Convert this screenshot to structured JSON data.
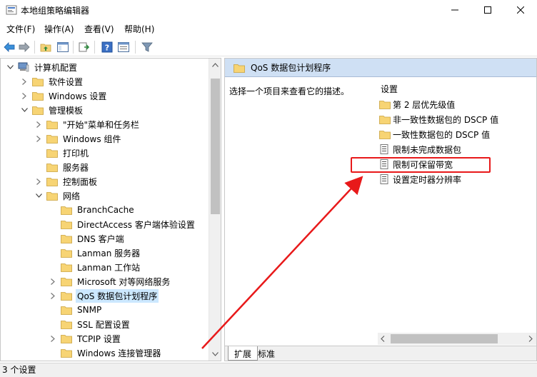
{
  "window": {
    "title": "本地组策略编辑器"
  },
  "menu": [
    "文件(F)",
    "操作(A)",
    "查看(V)",
    "帮助(H)"
  ],
  "tree": [
    {
      "label": "计算机配置",
      "exp": "open",
      "icon": "computer"
    },
    {
      "label": "软件设置",
      "exp": "closed",
      "icon": "folder"
    },
    {
      "label": "Windows 设置",
      "exp": "closed",
      "icon": "folder"
    },
    {
      "label": "管理模板",
      "exp": "open",
      "icon": "folder"
    },
    {
      "label": "\"开始\"菜单和任务栏",
      "exp": "closed",
      "icon": "folder"
    },
    {
      "label": "Windows 组件",
      "exp": "closed",
      "icon": "folder"
    },
    {
      "label": "打印机",
      "exp": "none",
      "icon": "folder"
    },
    {
      "label": "服务器",
      "exp": "none",
      "icon": "folder"
    },
    {
      "label": "控制面板",
      "exp": "closed",
      "icon": "folder"
    },
    {
      "label": "网络",
      "exp": "open",
      "icon": "folder"
    },
    {
      "label": "BranchCache",
      "exp": "none",
      "icon": "folder"
    },
    {
      "label": "DirectAccess 客户端体验设置",
      "exp": "none",
      "icon": "folder"
    },
    {
      "label": "DNS 客户端",
      "exp": "none",
      "icon": "folder"
    },
    {
      "label": "Lanman 服务器",
      "exp": "none",
      "icon": "folder"
    },
    {
      "label": "Lanman 工作站",
      "exp": "none",
      "icon": "folder"
    },
    {
      "label": "Microsoft 对等网络服务",
      "exp": "closed",
      "icon": "folder"
    },
    {
      "label": "QoS 数据包计划程序",
      "exp": "closed",
      "icon": "folder",
      "selected": true
    },
    {
      "label": "SNMP",
      "exp": "none",
      "icon": "folder"
    },
    {
      "label": "SSL 配置设置",
      "exp": "none",
      "icon": "folder"
    },
    {
      "label": "TCPIP 设置",
      "exp": "closed",
      "icon": "folder"
    },
    {
      "label": "Windows 连接管理器",
      "exp": "none",
      "icon": "folder"
    }
  ],
  "right": {
    "header": "QoS 数据包计划程序",
    "description": "选择一个项目来查看它的描述。",
    "column": "设置",
    "items": [
      {
        "label": "第 2 层优先级值",
        "icon": "folder"
      },
      {
        "label": "非一致性数据包的 DSCP 值",
        "icon": "folder"
      },
      {
        "label": "一致性数据包的 DSCP 值",
        "icon": "folder"
      },
      {
        "label": "限制未完成数据包",
        "icon": "setting"
      },
      {
        "label": "限制可保留带宽",
        "icon": "setting"
      },
      {
        "label": "设置定时器分辨率",
        "icon": "setting"
      }
    ],
    "tabs": [
      "扩展",
      "标准"
    ]
  },
  "status": "3 个设置",
  "colors": {
    "annotation": "#e8191a",
    "selection": "#cce8ff",
    "header": "#cfe0f4"
  }
}
